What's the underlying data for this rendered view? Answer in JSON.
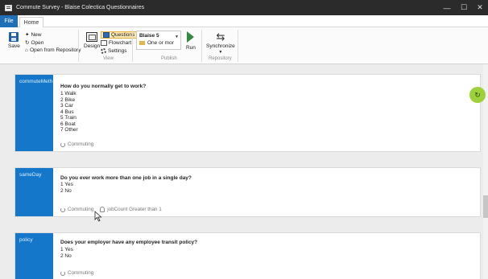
{
  "window": {
    "title": "Commute Survey - Blaise Colectica Questionnaires",
    "controls": [
      "—",
      "☐",
      "✕"
    ]
  },
  "tabs": {
    "file": "File",
    "home": "Home"
  },
  "ribbon": {
    "save": "Save",
    "new": "New",
    "open": "Open",
    "open_repo": "Open from Repository",
    "design": "Design",
    "questions": "Questions",
    "flowchart": "Flowchart",
    "settings": "Settings",
    "view_group": "View",
    "blaise_version": "Blaise 5",
    "mode": "One or mor",
    "run": "Run",
    "publish_group": "Publish",
    "synchronize": "Synchronize",
    "repository_group": "Repository"
  },
  "cards": [
    {
      "name": "commuteMeth",
      "question": "How do you normally get to work?",
      "options": [
        "1  Walk",
        "2  Bike",
        "3  Car",
        "4  Bus",
        "5  Train",
        "6  Boat",
        "7  Other"
      ],
      "sequence": "Commuting"
    },
    {
      "name": "sameDay",
      "question": "Do you ever work more than one job in a single day?",
      "options": [
        "1  Yes",
        "2  No"
      ],
      "sequence": "Commuting",
      "condition": "jobCount Greater than 1"
    },
    {
      "name": "policy",
      "question": "Does your employer have any employee transit policy?",
      "options": [
        "1  Yes",
        "2  No"
      ],
      "sequence": "Commuting"
    }
  ],
  "colors": {
    "accent": "#1477c9",
    "titlebar": "#2b2b2b",
    "fab": "#9dd13a"
  },
  "icons": {
    "fab": "refresh-icon"
  }
}
